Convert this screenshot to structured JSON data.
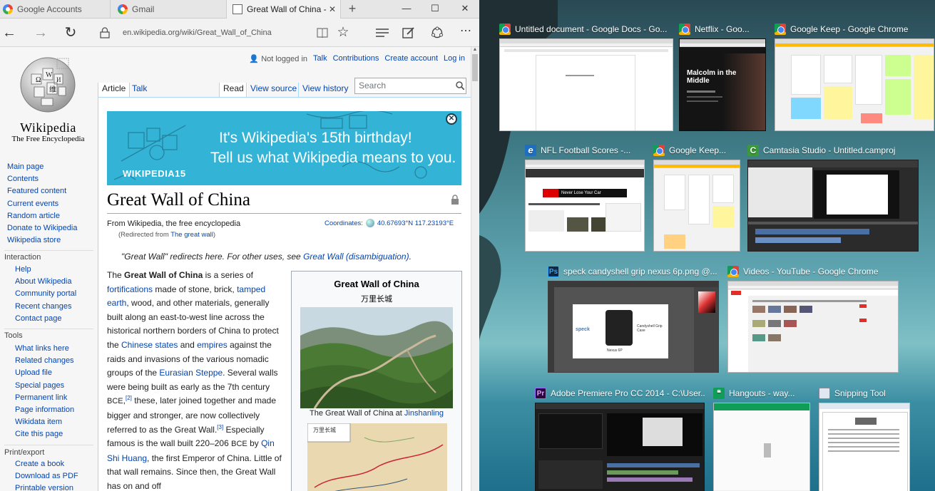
{
  "edge": {
    "tabs": [
      {
        "label": "Google Accounts",
        "icon": "google-icon"
      },
      {
        "label": "Gmail",
        "icon": "google-icon"
      },
      {
        "label": "Great Wall of China -",
        "icon": "page-icon",
        "active": true
      }
    ],
    "new_tab_label": "+",
    "url": "en.wikipedia.org/wiki/Great_Wall_of_China"
  },
  "wiki": {
    "wordmark": "Wikipedia",
    "tagline": "The Free Encyclopedia",
    "personal": {
      "not_logged_in": "Not logged in",
      "talk": "Talk",
      "contributions": "Contributions",
      "create_account": "Create account",
      "log_in": "Log in"
    },
    "tabs": {
      "article": "Article",
      "talk": "Talk",
      "read": "Read",
      "view_source": "View source",
      "view_history": "View history"
    },
    "search_placeholder": "Search",
    "nav": [
      "Main page",
      "Contents",
      "Featured content",
      "Current events",
      "Random article",
      "Donate to Wikipedia",
      "Wikipedia store"
    ],
    "interaction_heading": "Interaction",
    "interaction": [
      "Help",
      "About Wikipedia",
      "Community portal",
      "Recent changes",
      "Contact page"
    ],
    "tools_heading": "Tools",
    "tools": [
      "What links here",
      "Related changes",
      "Upload file",
      "Special pages",
      "Permanent link",
      "Page information",
      "Wikidata item",
      "Cite this page"
    ],
    "print_heading": "Print/export",
    "print": [
      "Create a book",
      "Download as PDF",
      "Printable version"
    ],
    "banner": {
      "line1": "It's Wikipedia's 15th birthday!",
      "line2": "Tell us what Wikipedia means to you.",
      "logo": "WIKIPEDIA15",
      "close": "✕"
    },
    "title": "Great Wall of China",
    "from": "From Wikipedia, the free encyclopedia",
    "redirected_prefix": "(Redirected from ",
    "redirected_link": "The great wall",
    "redirected_suffix": ")",
    "coordinates_label": "Coordinates:",
    "coordinates_value": "40.67693°N 117.23193°E",
    "hatnote_prefix": "\"Great Wall\" redirects here. For other uses, see ",
    "hatnote_link": "Great Wall (disambiguation)",
    "hatnote_suffix": ".",
    "body": {
      "t1": "The ",
      "b1": "Great Wall of China",
      "t2": " is a series of ",
      "l1": "fortifications",
      "t3": " made of stone, brick, ",
      "l2": "tamped earth",
      "t4": ", wood, and other materials, generally built along an east-to-west line across the historical northern borders of China to protect the ",
      "l3": "Chinese states",
      "t5": " and ",
      "l4": "empires",
      "t6": " against the raids and invasions of the various nomadic groups of the ",
      "l5": "Eurasian Steppe",
      "t7": ". Several walls were being built as early as the 7th century ",
      "sc1": "BCE",
      "sup1": "[2]",
      "t8": " these, later joined together and made bigger and stronger, are now collectively referred to as the Great Wall.",
      "sup2": "[3]",
      "t9": " Especially famous is the wall built 220–206 ",
      "sc2": "BCE",
      "t10": " by ",
      "l6": "Qin Shi Huang",
      "t11": ", the first Emperor of China. Little of that wall remains. Since then, the Great Wall has on and off"
    },
    "infobox": {
      "title": "Great Wall of China",
      "subtitle": "万里长城",
      "caption_prefix": "The Great Wall of China at ",
      "caption_link": "Jinshanling",
      "map_title": "万里长城"
    }
  },
  "taskview": {
    "windows": [
      {
        "title": "Untitled document - Google Docs - Go...",
        "icon": "chrome-icon"
      },
      {
        "title": "Netflix - Goo...",
        "icon": "chrome-icon",
        "thumb_text_1": "Malcolm in the",
        "thumb_text_2": "Middle"
      },
      {
        "title": "Google Keep - Google Chrome",
        "icon": "chrome-icon"
      },
      {
        "title": "NFL Football Scores -...",
        "icon": "ie-icon",
        "thumb_text": "Never Lose Your Car"
      },
      {
        "title": "Google Keep...",
        "icon": "chrome-icon"
      },
      {
        "title": "Camtasia Studio - Untitled.camproj",
        "icon": "camtasia-icon"
      },
      {
        "title": "speck candyshell grip nexus 6p.png @...",
        "icon": "photoshop-icon",
        "thumb_text_1": "speck",
        "thumb_text_2": "Candyshell Grip Case",
        "thumb_text_3": "Nexus 6P"
      },
      {
        "title": "Videos - YouTube - Google Chrome",
        "icon": "chrome-icon"
      },
      {
        "title": "Adobe Premiere Pro CC 2014 - C:\\User...",
        "icon": "premiere-icon"
      },
      {
        "title": "Hangouts - way...",
        "icon": "hangouts-icon"
      },
      {
        "title": "Snipping Tool",
        "icon": "snipping-tool-icon"
      }
    ]
  }
}
